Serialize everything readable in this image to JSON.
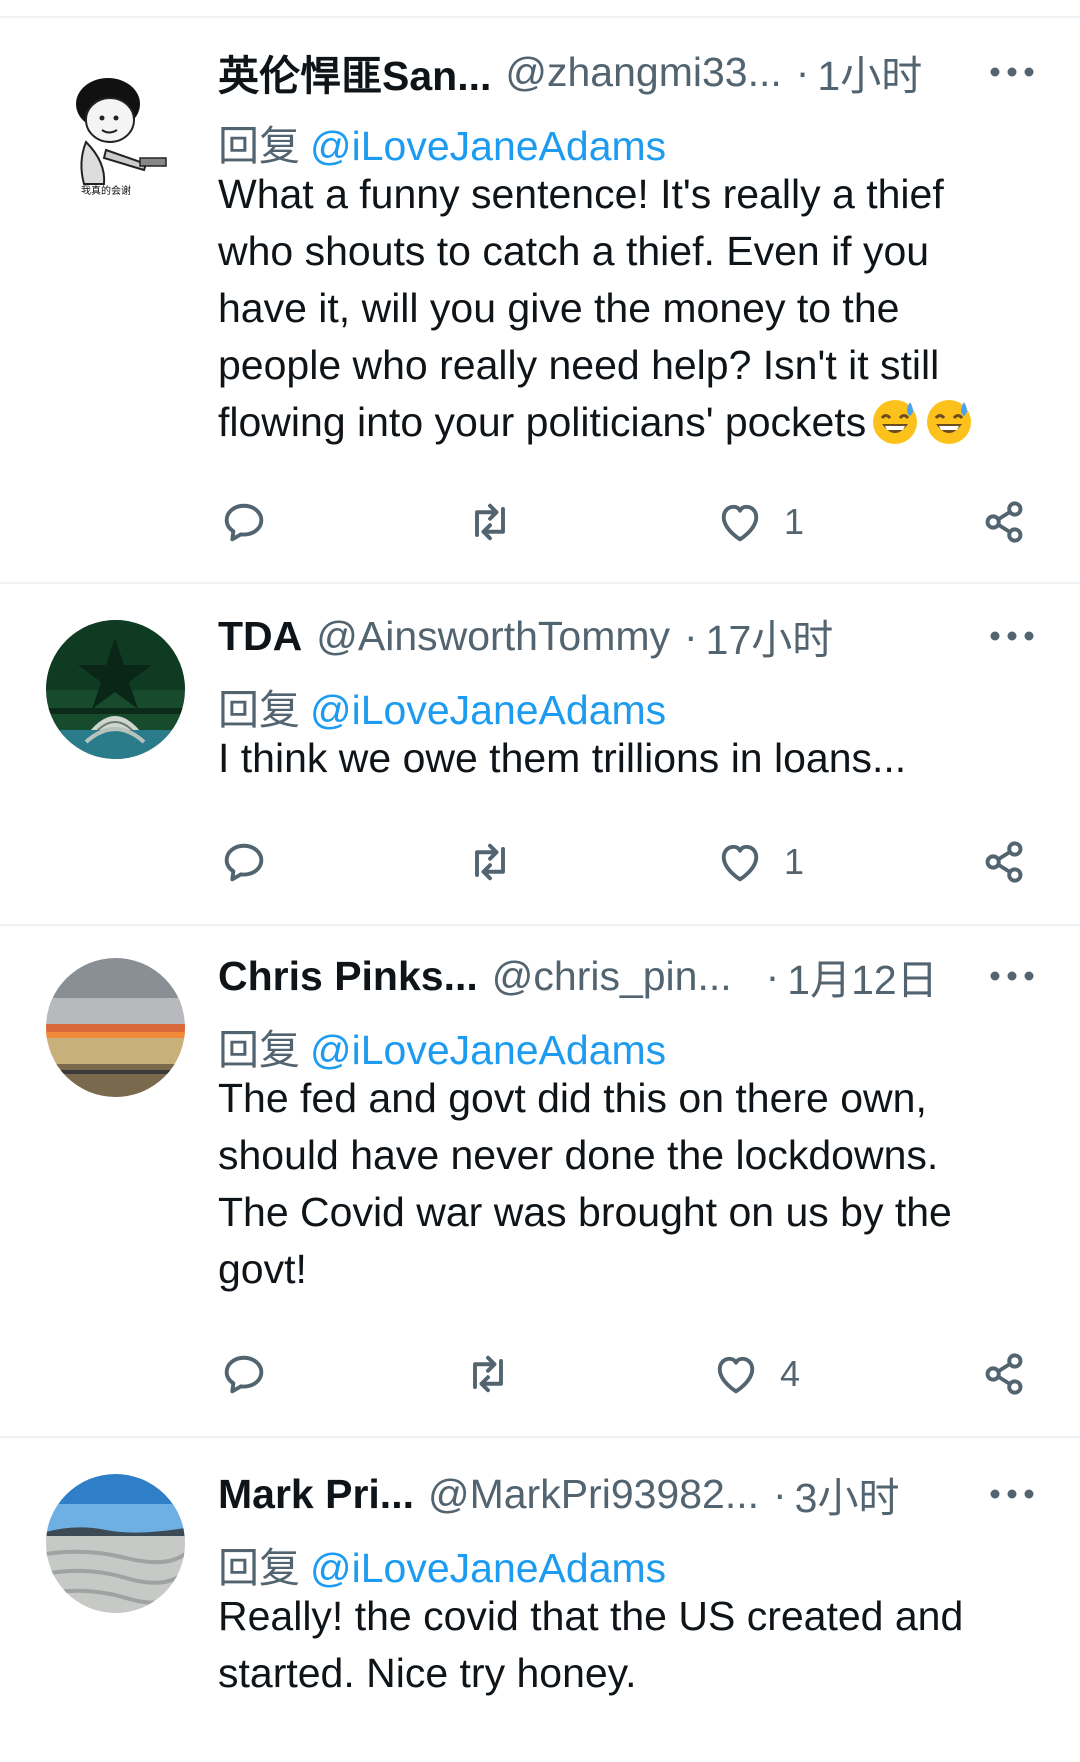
{
  "tweets": [
    {
      "display_name": "英伦悍匪San...",
      "handle": "@zhangmi33...",
      "separator": "·",
      "time": "1小时",
      "reply_prefix": "回复",
      "reply_to": "@iLoveJaneAdams",
      "text_lines": [
        "What a funny sentence! It's really a thief",
        "who shouts to catch a thief. Even if you",
        "have it, will you give the money to the",
        "people who really need help? Isn't it still",
        "flowing into your politicians' pockets"
      ],
      "emojis": [
        "grinning-face-with-sweat-icon",
        "grinning-face-with-sweat-icon"
      ],
      "avatar_caption": "我真的会谢",
      "like_count": "1",
      "retweet_count": "",
      "reply_count": ""
    },
    {
      "display_name": "TDA",
      "handle": "@AinsworthTommy",
      "separator": "·",
      "time": "17小时",
      "reply_prefix": "回复",
      "reply_to": "@iLoveJaneAdams",
      "text_lines": [
        "I think we owe them trillions in loans..."
      ],
      "like_count": "1",
      "retweet_count": "",
      "reply_count": ""
    },
    {
      "display_name": "Chris Pinks...",
      "handle": "@chris_pin...",
      "separator": "·",
      "time": "1月12日",
      "reply_prefix": "回复",
      "reply_to": "@iLoveJaneAdams",
      "text_lines": [
        "The fed and govt did this on there own,",
        "should have never done the lockdowns.",
        "The Covid war was brought on us by the",
        "govt!"
      ],
      "like_count": "4",
      "retweet_count": "",
      "reply_count": ""
    },
    {
      "display_name": "Mark Pri...",
      "handle": "@MarkPri93982...",
      "separator": "·",
      "time": "3小时",
      "reply_prefix": "回复",
      "reply_to": "@iLoveJaneAdams",
      "text_lines": [
        "Really! the covid that the US created and",
        "started. Nice try honey."
      ]
    }
  ],
  "colors": {
    "text": "#0f1419",
    "secondary": "#536471",
    "link": "#1d9bf0",
    "divider": "#eff3f4"
  },
  "icons": {
    "more": "more-horizontal-icon",
    "reply": "reply-bubble-icon",
    "retweet": "retweet-icon",
    "like": "heart-icon",
    "share": "share-icon"
  }
}
